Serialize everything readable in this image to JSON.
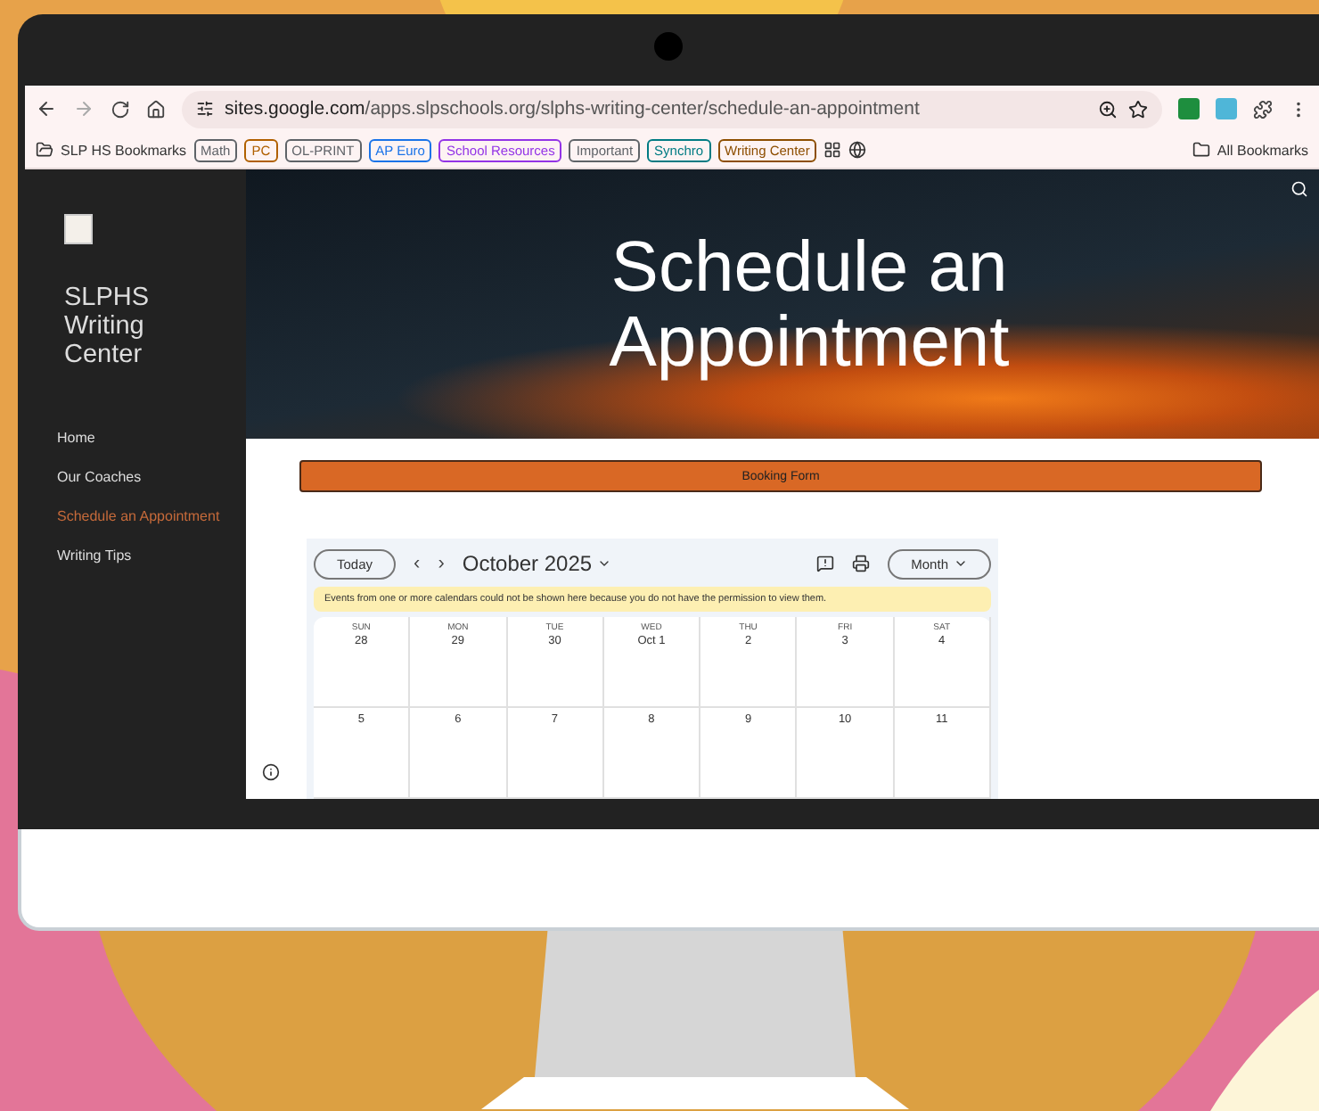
{
  "browser": {
    "url_host": "sites.google.com",
    "url_path": "/apps.slpschools.org/slphs-writing-center/schedule-an-appointment"
  },
  "bookmarks": {
    "folder": "SLP HS Bookmarks",
    "all": "All Bookmarks",
    "chips": [
      {
        "label": "Math",
        "color": "#5f6368"
      },
      {
        "label": "PC",
        "color": "#b06000"
      },
      {
        "label": "OL-PRINT",
        "color": "#5f6368"
      },
      {
        "label": "AP  Euro",
        "color": "#1a73e8"
      },
      {
        "label": "School Resources",
        "color": "#9334e6"
      },
      {
        "label": "Important",
        "color": "#5f6368"
      },
      {
        "label": "Synchro",
        "color": "#007b83"
      },
      {
        "label": "Writing Center",
        "color": "#8d4e00"
      }
    ]
  },
  "site": {
    "title_lines": [
      "SLPHS",
      "Writing",
      "Center"
    ],
    "nav": [
      {
        "label": "Home",
        "selected": false
      },
      {
        "label": "Our Coaches",
        "selected": false
      },
      {
        "label": "Schedule an Appointment",
        "selected": true
      },
      {
        "label": "Writing Tips",
        "selected": false
      }
    ],
    "hero_title_lines": [
      "Schedule an",
      "Appointment"
    ],
    "booking_button": "Booking Form"
  },
  "calendar": {
    "today": "Today",
    "prev": "‹",
    "next": "›",
    "month": "October 2025",
    "view": "Month",
    "notice": "Events from one or more calendars could not be shown here because you do not have the permission to view them.",
    "weeks": [
      [
        {
          "dow": "SUN",
          "date": "28"
        },
        {
          "dow": "MON",
          "date": "29"
        },
        {
          "dow": "TUE",
          "date": "30"
        },
        {
          "dow": "WED",
          "date": "Oct 1"
        },
        {
          "dow": "THU",
          "date": "2"
        },
        {
          "dow": "FRI",
          "date": "3"
        },
        {
          "dow": "SAT",
          "date": "4"
        }
      ],
      [
        {
          "date": "5"
        },
        {
          "date": "6"
        },
        {
          "date": "7"
        },
        {
          "date": "8"
        },
        {
          "date": "9"
        },
        {
          "date": "10"
        },
        {
          "date": "11"
        }
      ]
    ]
  }
}
